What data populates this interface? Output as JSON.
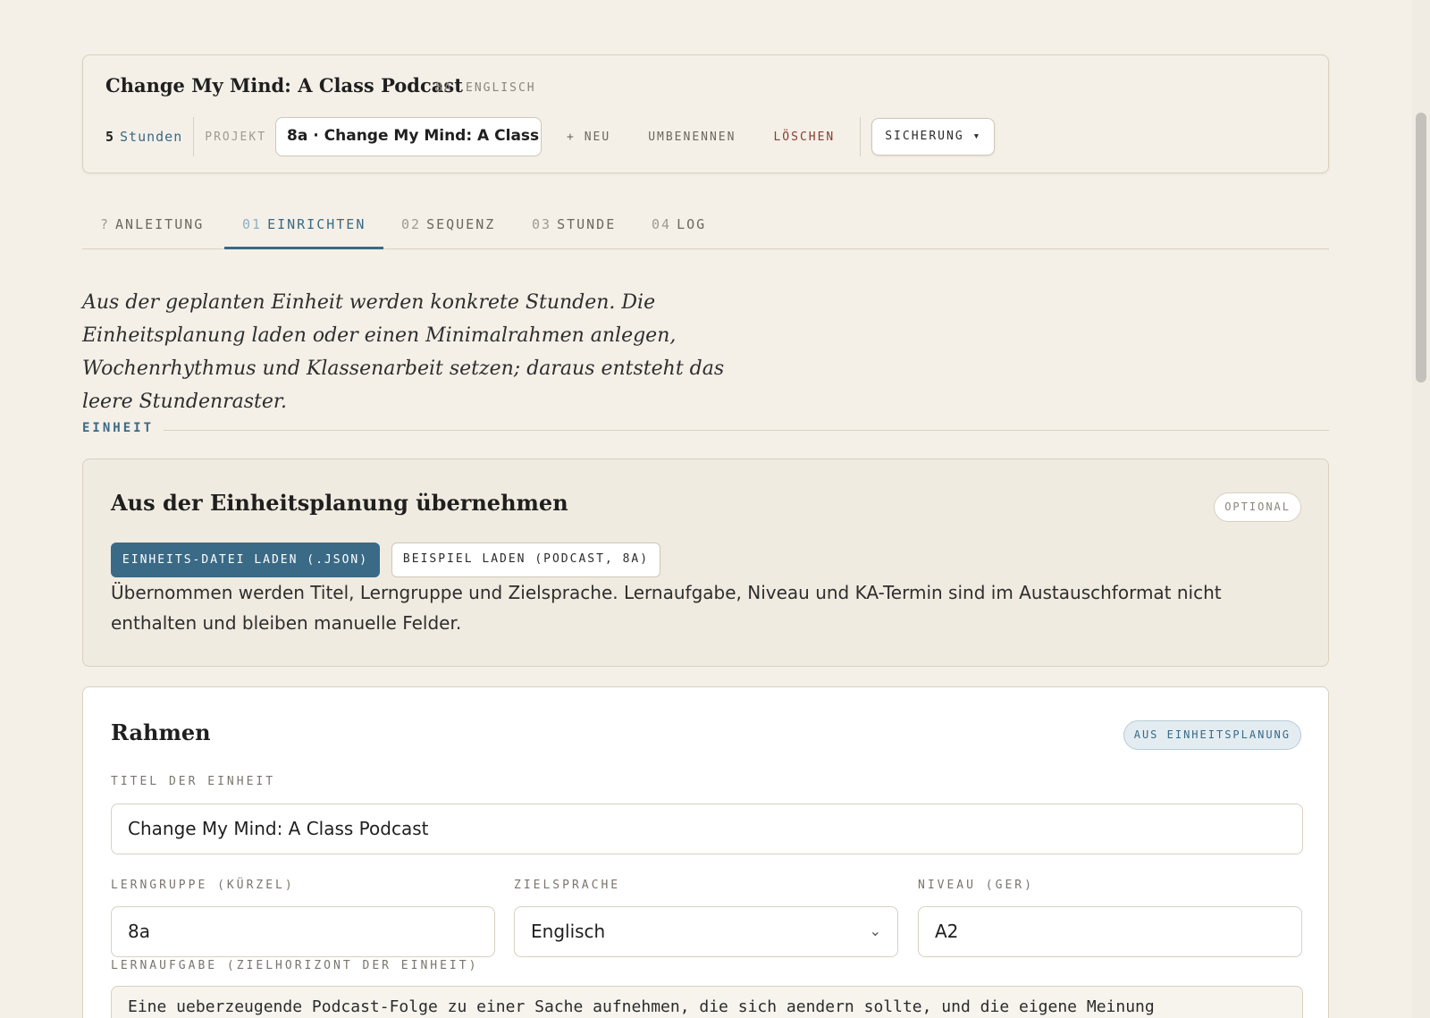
{
  "header": {
    "title": "Change My Mind: A Class Podcast",
    "class_tag": "8A",
    "language_tag": "ENGLISCH",
    "hours_count": "5",
    "hours_label": "Stunden",
    "project_label": "PROJEKT",
    "project_value": "8a · Change My Mind: A Class Podcast",
    "new_label": "+ NEU",
    "rename_label": "UMBENENNEN",
    "delete_label": "LÖSCHEN",
    "backup_label": "SICHERUNG ▾"
  },
  "tabs": [
    {
      "num": "?",
      "label": "ANLEITUNG",
      "active": false
    },
    {
      "num": "01",
      "label": "EINRICHTEN",
      "active": true
    },
    {
      "num": "02",
      "label": "SEQUENZ",
      "active": false
    },
    {
      "num": "03",
      "label": "STUNDE",
      "active": false
    },
    {
      "num": "04",
      "label": "LOG",
      "active": false
    }
  ],
  "intro": "Aus der geplanten Einheit werden konkrete Stunden. Die Einheitsplanung laden oder einen Minimalrahmen anlegen, Wochenrhythmus und Klassenarbeit setzen; daraus entsteht das leere Stundenraster.",
  "section": {
    "label": "EINHEIT"
  },
  "import_card": {
    "title": "Aus der Einheitsplanung übernehmen",
    "badge": "OPTIONAL",
    "load_file_label": "EINHEITS-DATEI LADEN (.JSON)",
    "load_example_label": "BEISPIEL LADEN (PODCAST, 8A)",
    "note": "Übernommen werden Titel, Lerngruppe und Zielsprache. Lernaufgabe, Niveau und KA-Termin sind im Austauschformat nicht enthalten und bleiben manuelle Felder."
  },
  "frame_card": {
    "title": "Rahmen",
    "badge": "AUS EINHEITSPLANUNG",
    "unit_title_label": "TITEL DER EINHEIT",
    "unit_title_value": "Change My Mind: A Class Podcast",
    "group_label": "LERNGRUPPE (KÜRZEL)",
    "group_value": "8a",
    "language_label": "ZIELSPRACHE",
    "language_value": "Englisch",
    "level_label": "NIVEAU (GER)",
    "level_value": "A2",
    "task_label": "LERNAUFGABE (ZIELHORIZONT DER EINHEIT)",
    "task_value": "Eine ueberzeugende Podcast-Folge zu einer Sache aufnehmen, die sich aendern sollte, und die eigene Meinung"
  },
  "icons": {
    "select_chevron": "chevron-down-icon"
  },
  "colors": {
    "accent": "#3a6a86",
    "danger": "#8a3b2e",
    "background": "#f4f0e8"
  }
}
